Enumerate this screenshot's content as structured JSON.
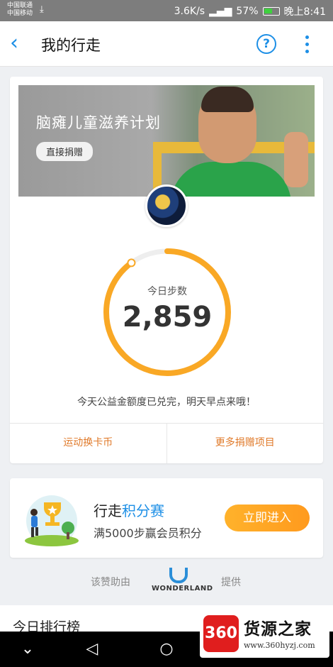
{
  "status_bar": {
    "carrier1": "中国联通",
    "carrier2": "中国移动",
    "speed": "3.6K/s",
    "battery": "57%",
    "time": "晚上8:41"
  },
  "header": {
    "title": "我的行走",
    "help_label": "?"
  },
  "banner": {
    "title": "脑瘫儿童滋养计划",
    "donate_label": "直接捐赠"
  },
  "steps": {
    "label": "今日步数",
    "value": "2,859",
    "progress": 0.9
  },
  "message": "今天公益金额度已兑完，明天早点来哦！",
  "actions": {
    "exchange_label": "运动换卡币",
    "more_label": "更多捐赠项目"
  },
  "promo": {
    "title_prefix": "行走",
    "title_emph": "积分赛",
    "subtitle": "满5000步赢会员积分",
    "button_label": "立即进入"
  },
  "powered": {
    "prefix": "该赞助由",
    "brand": "WONDERLAND",
    "suffix": "提供"
  },
  "ranking": {
    "title": "今日排行榜"
  },
  "watermark": {
    "badge": "360",
    "name": "货源之家",
    "url": "www.360hyzj.com"
  },
  "colors": {
    "accent_blue": "#1d8fe6",
    "ring_orange": "#f9a825",
    "action_orange": "#e07a2a"
  }
}
